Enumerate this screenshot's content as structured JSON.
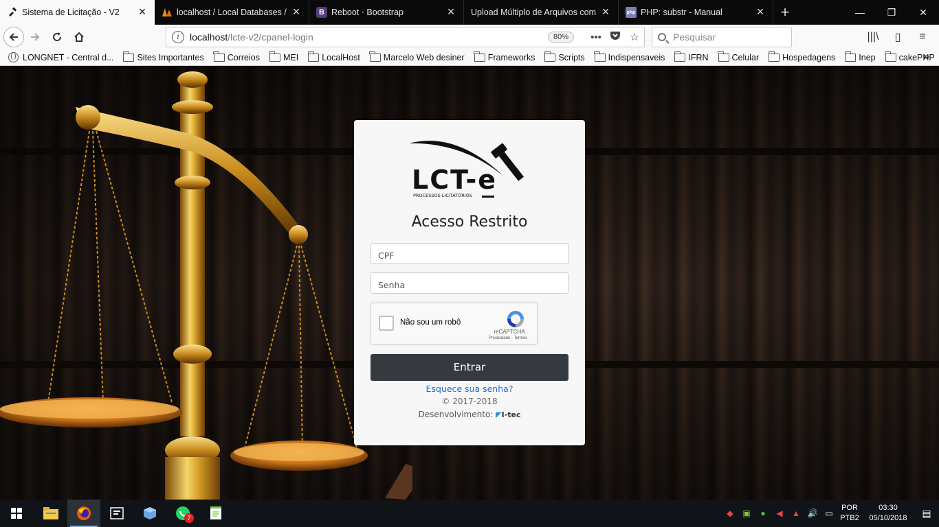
{
  "browser": {
    "tabs": [
      {
        "title": "Sistema de Licitação - V2",
        "active": true,
        "favicon": "gavel-icon"
      },
      {
        "title": "localhost / Local Databases / lc",
        "active": false,
        "favicon": "phpmyadmin-icon"
      },
      {
        "title": "Reboot · Bootstrap",
        "active": false,
        "favicon": "bootstrap-icon"
      },
      {
        "title": "Upload Múltiplo de Arquivos com P",
        "active": false,
        "favicon": "none"
      },
      {
        "title": "PHP: substr - Manual",
        "active": false,
        "favicon": "php-icon"
      }
    ],
    "url_host": "localhost",
    "url_path": "/lcte-v2/cpanel-login",
    "zoom": "80%",
    "search_placeholder": "Pesquisar",
    "bookmarks": [
      {
        "label": "LONGNET - Central d...",
        "icon": "globe-icon"
      },
      {
        "label": "Sites Importantes",
        "icon": "folder-icon"
      },
      {
        "label": "Correios",
        "icon": "folder-icon"
      },
      {
        "label": "MEI",
        "icon": "folder-icon"
      },
      {
        "label": "LocalHost",
        "icon": "folder-icon"
      },
      {
        "label": "Marcelo Web desiner",
        "icon": "folder-icon"
      },
      {
        "label": "Frameworks",
        "icon": "folder-icon"
      },
      {
        "label": "Scripts",
        "icon": "folder-icon"
      },
      {
        "label": "Indispensaveis",
        "icon": "folder-icon"
      },
      {
        "label": "IFRN",
        "icon": "folder-icon"
      },
      {
        "label": "Celular",
        "icon": "folder-icon"
      },
      {
        "label": "Hospedagens",
        "icon": "folder-icon"
      },
      {
        "label": "Inep",
        "icon": "folder-icon"
      },
      {
        "label": "cakePHP",
        "icon": "folder-icon"
      }
    ]
  },
  "login": {
    "logo_text": "LCT-e",
    "logo_subtitle": "PROCESSOS LICITATÓRIOS",
    "heading": "Acesso Restrito",
    "cpf_placeholder": "CPF",
    "senha_placeholder": "Senha",
    "captcha_label": "Não sou um robô",
    "captcha_brand": "reCAPTCHA",
    "captcha_links": "Privacidade - Termos",
    "submit_label": "Entrar",
    "forgot_label": "Esquece sua senha?",
    "copyright": "© 2017-2018",
    "dev_label": "Desenvolvimento:",
    "dev_brand": "I-tec",
    "button_color": "#343a40",
    "link_color": "#1e6bd6"
  },
  "taskbar": {
    "apps": [
      "start-icon",
      "file-explorer-icon",
      "firefox-icon",
      "terminal-icon",
      "virtualbox-icon",
      "whatsapp-icon",
      "notepad-icon"
    ],
    "whatsapp_badge": "7",
    "lang_top": "POR",
    "lang_bottom": "PTB2",
    "time": "03:30",
    "date": "05/10/2018"
  }
}
